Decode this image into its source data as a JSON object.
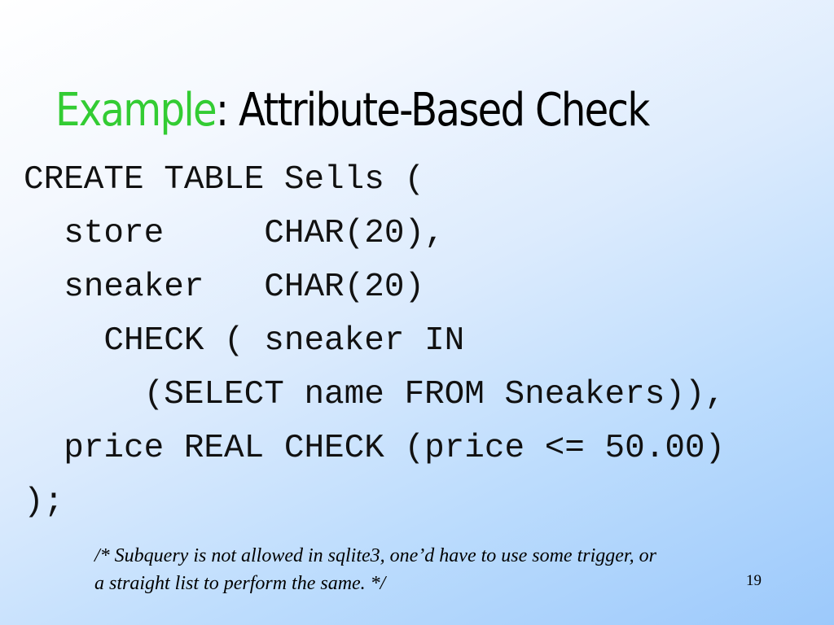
{
  "slide": {
    "title_accent": "Example",
    "title_rest": ": Attribute-Based Check",
    "code_lines": [
      "CREATE TABLE Sells (",
      "  store     CHAR(20),",
      "  sneaker   CHAR(20)",
      "    CHECK ( sneaker IN",
      "      (SELECT name FROM Sneakers)),",
      "  price REAL CHECK (price <= 50.00)",
      ");"
    ],
    "note_lines": [
      "/* Subquery is not allowed in sqlite3, one’d have to use some trigger, or",
      "a straight list to perform the same. */"
    ],
    "page_number": "19",
    "colors": {
      "title_accent": "#33cc33",
      "background_start": "#ffffff",
      "background_end": "#9cc9fb"
    }
  }
}
